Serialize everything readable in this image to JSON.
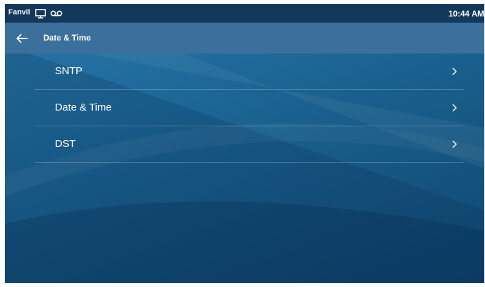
{
  "status_bar": {
    "brand": "Fanvil",
    "time": "10:44 AM",
    "icons": [
      "monitor-icon",
      "voicemail-icon"
    ]
  },
  "title_bar": {
    "back_icon": "arrow-left-icon",
    "title": "Date & Time"
  },
  "menu": {
    "items": [
      {
        "label": "SNTP",
        "icon": "chevron-right-icon"
      },
      {
        "label": "Date & Time",
        "icon": "chevron-right-icon"
      },
      {
        "label": "DST",
        "icon": "chevron-right-icon"
      }
    ]
  },
  "colors": {
    "status_bar": "#14385a",
    "title_bar": "#3b6f9c",
    "background_top": "#2a78a8",
    "background_bottom": "#0f4670",
    "text": "#ffffff"
  }
}
